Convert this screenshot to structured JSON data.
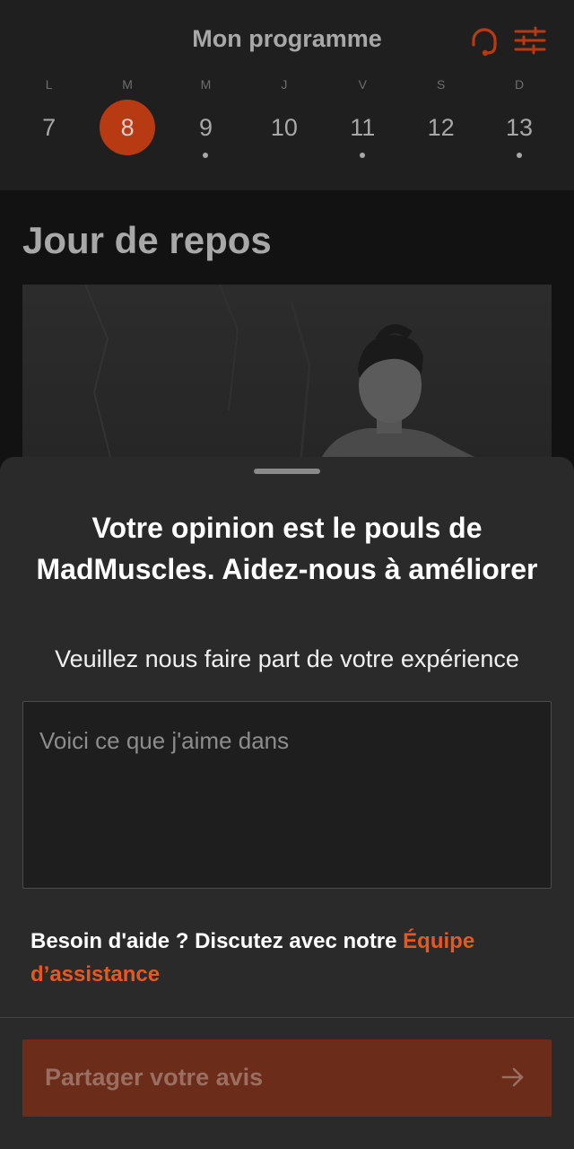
{
  "header": {
    "title": "Mon programme",
    "icons": {
      "support": "headset-icon",
      "filters": "sliders-icon"
    }
  },
  "calendar": {
    "days": [
      {
        "letter": "L",
        "number": "7",
        "selected": false,
        "dot": false
      },
      {
        "letter": "M",
        "number": "8",
        "selected": true,
        "dot": false
      },
      {
        "letter": "M",
        "number": "9",
        "selected": false,
        "dot": true
      },
      {
        "letter": "J",
        "number": "10",
        "selected": false,
        "dot": false
      },
      {
        "letter": "V",
        "number": "11",
        "selected": false,
        "dot": true
      },
      {
        "letter": "S",
        "number": "12",
        "selected": false,
        "dot": false
      },
      {
        "letter": "D",
        "number": "13",
        "selected": false,
        "dot": true
      }
    ]
  },
  "main": {
    "rest_title": "Jour de repos"
  },
  "sheet": {
    "title": "Votre opinion est le pouls de MadMuscles. Aidez-nous à améliorer",
    "subtitle": "Veuillez nous faire part de votre expérience",
    "input_placeholder": "Voici ce que j'aime dans",
    "input_value": "",
    "help_prefix": "Besoin d'aide ? Discutez avec notre ",
    "help_link": "Équipe d’assistance",
    "submit_label": "Partager votre avis",
    "submit_icon": "arrow-right-icon"
  },
  "colors": {
    "accent": "#e8581e",
    "selected_day": "#b83a12",
    "sheet_background": "#2a2a2a",
    "button_disabled": "#6b2c19"
  }
}
